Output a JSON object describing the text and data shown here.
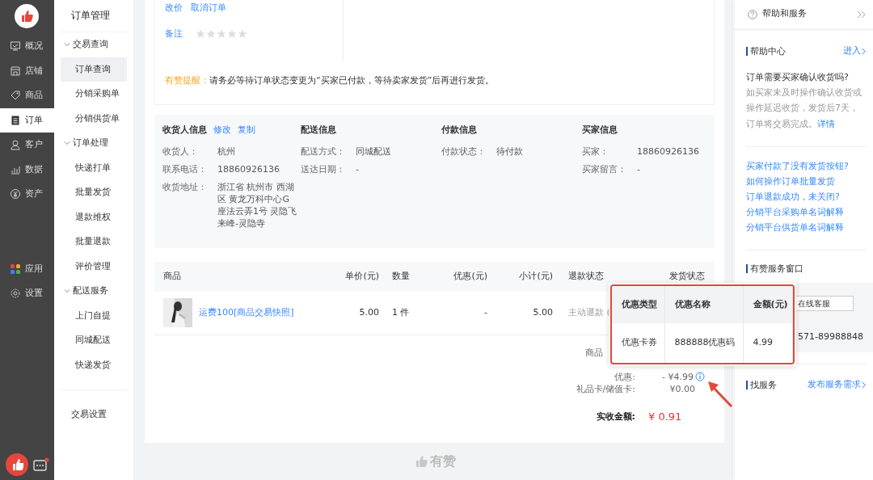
{
  "rail": {
    "items": [
      {
        "label": "概况",
        "selected": false
      },
      {
        "label": "店铺",
        "selected": false
      },
      {
        "label": "商品",
        "selected": false
      },
      {
        "label": "订单",
        "selected": true
      },
      {
        "label": "客户",
        "selected": false
      },
      {
        "label": "数据",
        "selected": false
      },
      {
        "label": "资产",
        "selected": false
      }
    ],
    "bottom_items": [
      {
        "label": "应用",
        "selected": false
      },
      {
        "label": "设置",
        "selected": false
      }
    ],
    "chat_unread": true
  },
  "subnav": {
    "title": "订单管理",
    "groups": [
      {
        "label": "交易查询",
        "expanded": true,
        "children": [
          {
            "label": "订单查询",
            "selected": true
          },
          {
            "label": "分销采购单",
            "selected": false
          },
          {
            "label": "分销供货单",
            "selected": false
          }
        ]
      },
      {
        "label": "订单处理",
        "expanded": true,
        "children": [
          {
            "label": "快递打单",
            "selected": false
          },
          {
            "label": "批量发货",
            "selected": false
          },
          {
            "label": "退款维权",
            "selected": false
          },
          {
            "label": "批量退款",
            "selected": false
          },
          {
            "label": "评价管理",
            "selected": false
          }
        ]
      },
      {
        "label": "配送服务",
        "expanded": true,
        "children": [
          {
            "label": "上门自提",
            "selected": false
          },
          {
            "label": "同城配送",
            "selected": false
          },
          {
            "label": "快递发货",
            "selected": false
          }
        ]
      }
    ],
    "footer_items": [
      {
        "label": "交易设置",
        "selected": false
      }
    ]
  },
  "order_actions": [
    "改价",
    "取消订单"
  ],
  "remark": {
    "label": "备注",
    "stars": 0
  },
  "reminder": {
    "title": "有赞提醒：",
    "text": "请务必等待订单状态变更为“买家已付款，等待卖家发货”后再进行发货。"
  },
  "info_sections": [
    {
      "title": "收货人信息",
      "actions": [
        "修改",
        "复制"
      ],
      "fields": [
        {
          "label": "收货人：",
          "value": "杭州"
        },
        {
          "label": "联系电话：",
          "value": "18860926136"
        },
        {
          "label": "收货地址：",
          "value": "浙江省 杭州市 西湖区 黄龙万科中心G座法云弄1号 灵隐飞来峰-灵隐寺"
        }
      ]
    },
    {
      "title": "配送信息",
      "fields": [
        {
          "label": "配送方式：",
          "value": "同城配送"
        },
        {
          "label": "送达日期：",
          "value": "-"
        }
      ]
    },
    {
      "title": "付款信息",
      "fields": [
        {
          "label": "付款状态：",
          "value": "待付款"
        }
      ]
    },
    {
      "title": "买家信息",
      "fields": [
        {
          "label": "买家：",
          "value": "18860926136"
        },
        {
          "label": "买家留言：",
          "value": "-"
        }
      ]
    }
  ],
  "items_table": {
    "columns": [
      "商品",
      "单价(元)",
      "数量",
      "优惠(元)",
      "小计(元)",
      "退款状态",
      "发货状态"
    ],
    "rows": [
      {
        "product": "运费100[商品交易快照]",
        "price": "5.00",
        "quantity": "1 件",
        "discount": "-",
        "subtotal": "5.00",
        "refund": "主动退款 ("
      }
    ]
  },
  "summary": {
    "rows": [
      {
        "label": "商品"
      },
      {
        "label": "优惠:",
        "value": "- ¥4.99",
        "info": true
      },
      {
        "label": "礼品卡/储值卡:",
        "value": "¥0.00",
        "info": false
      }
    ],
    "total": {
      "label": "实收金额:",
      "value": "¥ 0.91"
    }
  },
  "discount_popover": {
    "columns": [
      "优惠类型",
      "优惠名称",
      "金额(元)"
    ],
    "rows": [
      [
        "优惠卡券",
        "888888优惠码",
        "4.99"
      ]
    ]
  },
  "footer_logo": "有赞",
  "help_panel": {
    "title": "帮助和服务",
    "center": {
      "title": "帮助中心",
      "link": "进入",
      "question": "订单需要买家确认收货吗?",
      "answer": "如买家未及时操作确认收货或操作延迟收货，发货后7天，订单将交易完成。",
      "detail_link": "详情"
    },
    "links": [
      "买家付款了没有发货按钮?",
      "如何操作订单批量发货",
      "订单退款成功，未关闭?",
      "分销平台采购单名词解释",
      "分销平台供货单名词解释"
    ],
    "service": {
      "title": "有赞服务窗口",
      "button": "在线客服",
      "phone": "571-89988848"
    },
    "find": {
      "title": "找服务",
      "link": "发布服务需求"
    }
  }
}
